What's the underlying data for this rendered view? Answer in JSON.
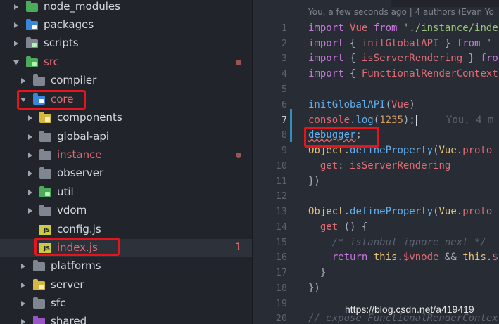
{
  "explorer": {
    "rows": [
      {
        "label": "node_modules"
      },
      {
        "label": "packages"
      },
      {
        "label": "scripts"
      },
      {
        "label": "src"
      },
      {
        "label": "compiler"
      },
      {
        "label": "core"
      },
      {
        "label": "components"
      },
      {
        "label": "global-api"
      },
      {
        "label": "instance"
      },
      {
        "label": "observer"
      },
      {
        "label": "util"
      },
      {
        "label": "vdom"
      },
      {
        "label": "config.js"
      },
      {
        "label": "index.js",
        "problems": "1"
      },
      {
        "label": "platforms"
      },
      {
        "label": "server"
      },
      {
        "label": "sfc"
      },
      {
        "label": "shared"
      }
    ],
    "js_icon_text": "JS"
  },
  "editor": {
    "blame_header": "You, a few seconds ago | 4 authors (Evan Yo",
    "inline_blame": "You, 4 m",
    "line_numbers": [
      "1",
      "2",
      "3",
      "4",
      "5",
      "6",
      "7",
      "8",
      "9",
      "10",
      "11",
      "12",
      "13",
      "14",
      "15",
      "16",
      "17",
      "18",
      "19",
      "20"
    ],
    "code": {
      "l1": {
        "kw": "import",
        "name": "Vue",
        "from": "from",
        "path": "'./instance/inde"
      },
      "l2": {
        "kw": "import",
        "open": "{ ",
        "name": "initGlobalAPI",
        "close": " }",
        "from": "from",
        "path": "'"
      },
      "l3": {
        "kw": "import",
        "open": "{ ",
        "name": "isServerRendering",
        "close": " }",
        "from": "fro"
      },
      "l4": {
        "kw": "import",
        "open": "{ ",
        "name": "FunctionalRenderContext"
      },
      "l6": {
        "fn": "initGlobalAPI",
        "open": "(",
        "arg": "Vue",
        "close": ")"
      },
      "l7": {
        "obj": "console",
        "dot": ".",
        "fn": "log",
        "open": "(",
        "num": "1235",
        "close": ");"
      },
      "l8": {
        "kw": "debugger",
        "semi": ";"
      },
      "l9": {
        "obj": "Object",
        "dot": ".",
        "fn": "defineProperty",
        "open": "(",
        "arg": "Vue",
        "dot2": ".",
        "prop": "proto"
      },
      "l10": {
        "key": "get",
        "colon": ": ",
        "val": "isServerRendering"
      },
      "l11": {
        "text": "})"
      },
      "l13": {
        "obj": "Object",
        "dot": ".",
        "fn": "defineProperty",
        "open": "(",
        "arg": "Vue",
        "dot2": ".",
        "prop": "proto"
      },
      "l14": {
        "fn": "get",
        "rest": " () {"
      },
      "l15": {
        "comment": "/* istanbul ignore next */"
      },
      "l16": {
        "kw": "return",
        "this1": "this",
        "dot": ".",
        "prop": "$vnode",
        "op": " && ",
        "this2": "this",
        "dot2": ".",
        "tail": "$"
      },
      "l17": {
        "text": "}"
      },
      "l18": {
        "text": "})"
      },
      "l20": {
        "comment": "// expose FunctionalRenderContex"
      }
    }
  },
  "watermark": "https://blog.csdn.net/a419419",
  "colors": {
    "highlight_box": "#e8141c",
    "modified": "#e06c75",
    "keyword": "#c678dd",
    "string": "#98c379",
    "function": "#61afef"
  }
}
